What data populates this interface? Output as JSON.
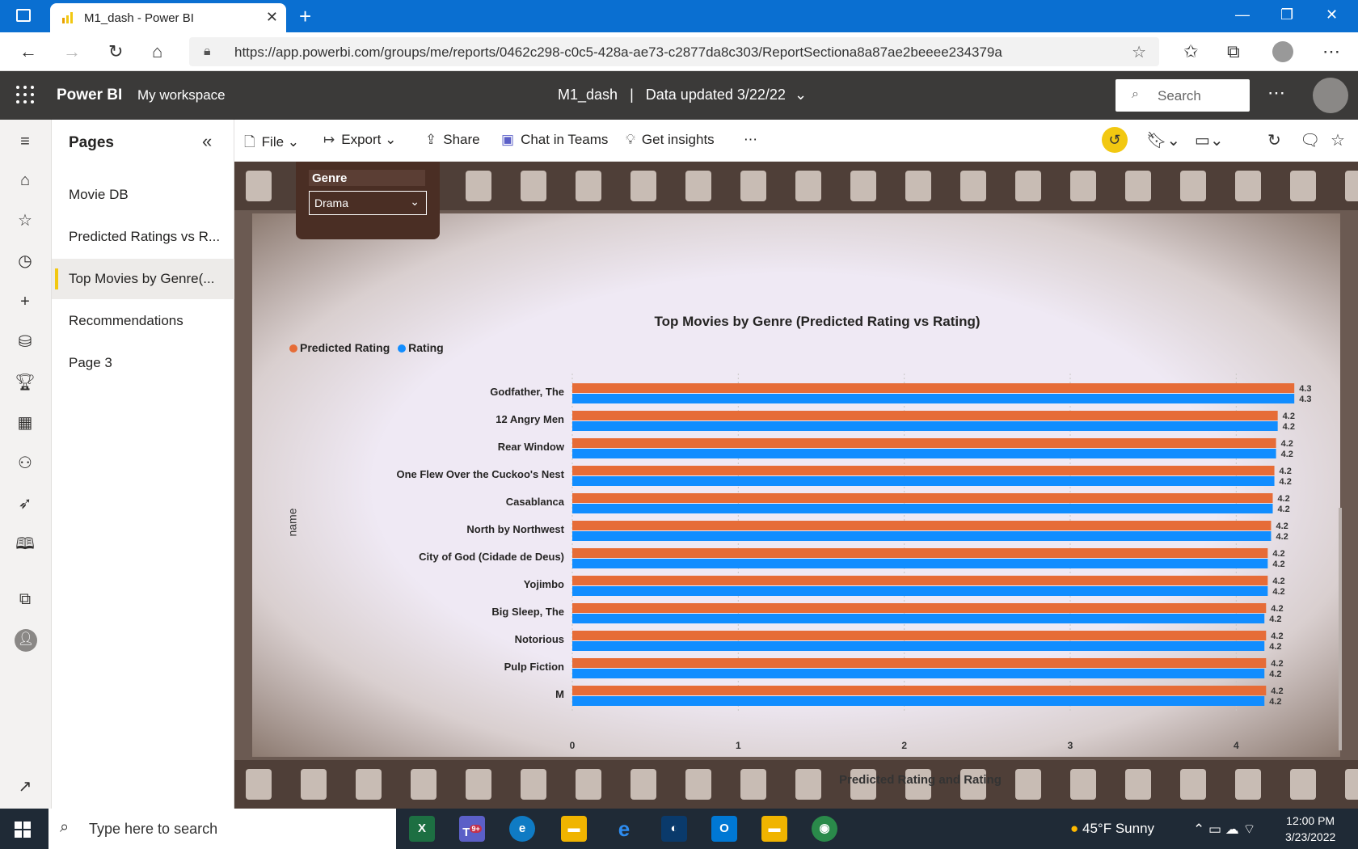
{
  "browser": {
    "tab_title": "M1_dash - Power BI",
    "url": "https://app.powerbi.com/groups/me/reports/0462c298-c0c5-428a-ae73-c2877da8c303/ReportSectiona8a87ae2beeee234379a"
  },
  "header": {
    "brand": "Power BI",
    "workspace": "My workspace",
    "report_name": "M1_dash",
    "data_updated": "Data updated 3/22/22",
    "search_placeholder": "Search"
  },
  "pages_pane": {
    "title": "Pages",
    "items": [
      {
        "label": "Movie DB"
      },
      {
        "label": "Predicted Ratings vs R..."
      },
      {
        "label": "Top Movies by Genre(..."
      },
      {
        "label": "Recommendations"
      },
      {
        "label": "Page 3"
      }
    ],
    "active_index": 2
  },
  "actionbar": {
    "file": "File",
    "export": "Export",
    "share": "Share",
    "chat": "Chat in Teams",
    "insights": "Get insights"
  },
  "slicer": {
    "label": "Genre",
    "value": "Drama"
  },
  "colors": {
    "predicted": "#e66c37",
    "rating": "#118dff",
    "accent": "#f2c811"
  },
  "chart_data": {
    "type": "bar",
    "orientation": "horizontal",
    "title": "Top Movies by Genre (Predicted Rating vs Rating)",
    "xlabel": "Predicted Rating and Rating",
    "ylabel": "name",
    "xlim": [
      0,
      4.5
    ],
    "xticks": [
      0,
      1,
      2,
      3,
      4
    ],
    "legend_position": "top-left",
    "categories": [
      "Godfather, The",
      "12 Angry Men",
      "Rear Window",
      "One Flew Over the Cuckoo's Nest",
      "Casablanca",
      "North by Northwest",
      "City of God (Cidade de Deus)",
      "Yojimbo",
      "Big Sleep, The",
      "Notorious",
      "Pulp Fiction",
      "M"
    ],
    "series": [
      {
        "name": "Predicted Rating",
        "values": [
          4.35,
          4.25,
          4.24,
          4.23,
          4.22,
          4.21,
          4.19,
          4.19,
          4.18,
          4.18,
          4.18,
          4.18
        ],
        "labels": [
          "4.3",
          "4.2",
          "4.2",
          "4.2",
          "4.2",
          "4.2",
          "4.2",
          "4.2",
          "4.2",
          "4.2",
          "4.2",
          "4.2"
        ]
      },
      {
        "name": "Rating",
        "values": [
          4.35,
          4.25,
          4.24,
          4.23,
          4.22,
          4.21,
          4.19,
          4.19,
          4.17,
          4.17,
          4.17,
          4.17
        ],
        "labels": [
          "4.3",
          "4.2",
          "4.2",
          "4.2",
          "4.2",
          "4.2",
          "4.2",
          "4.2",
          "4.2",
          "4.2",
          "4.2",
          "4.2"
        ]
      }
    ]
  },
  "taskbar": {
    "search_placeholder": "Type here to search",
    "weather": "45°F  Sunny",
    "time": "12:00 PM",
    "date": "3/23/2022",
    "teams_badge": "9+"
  }
}
